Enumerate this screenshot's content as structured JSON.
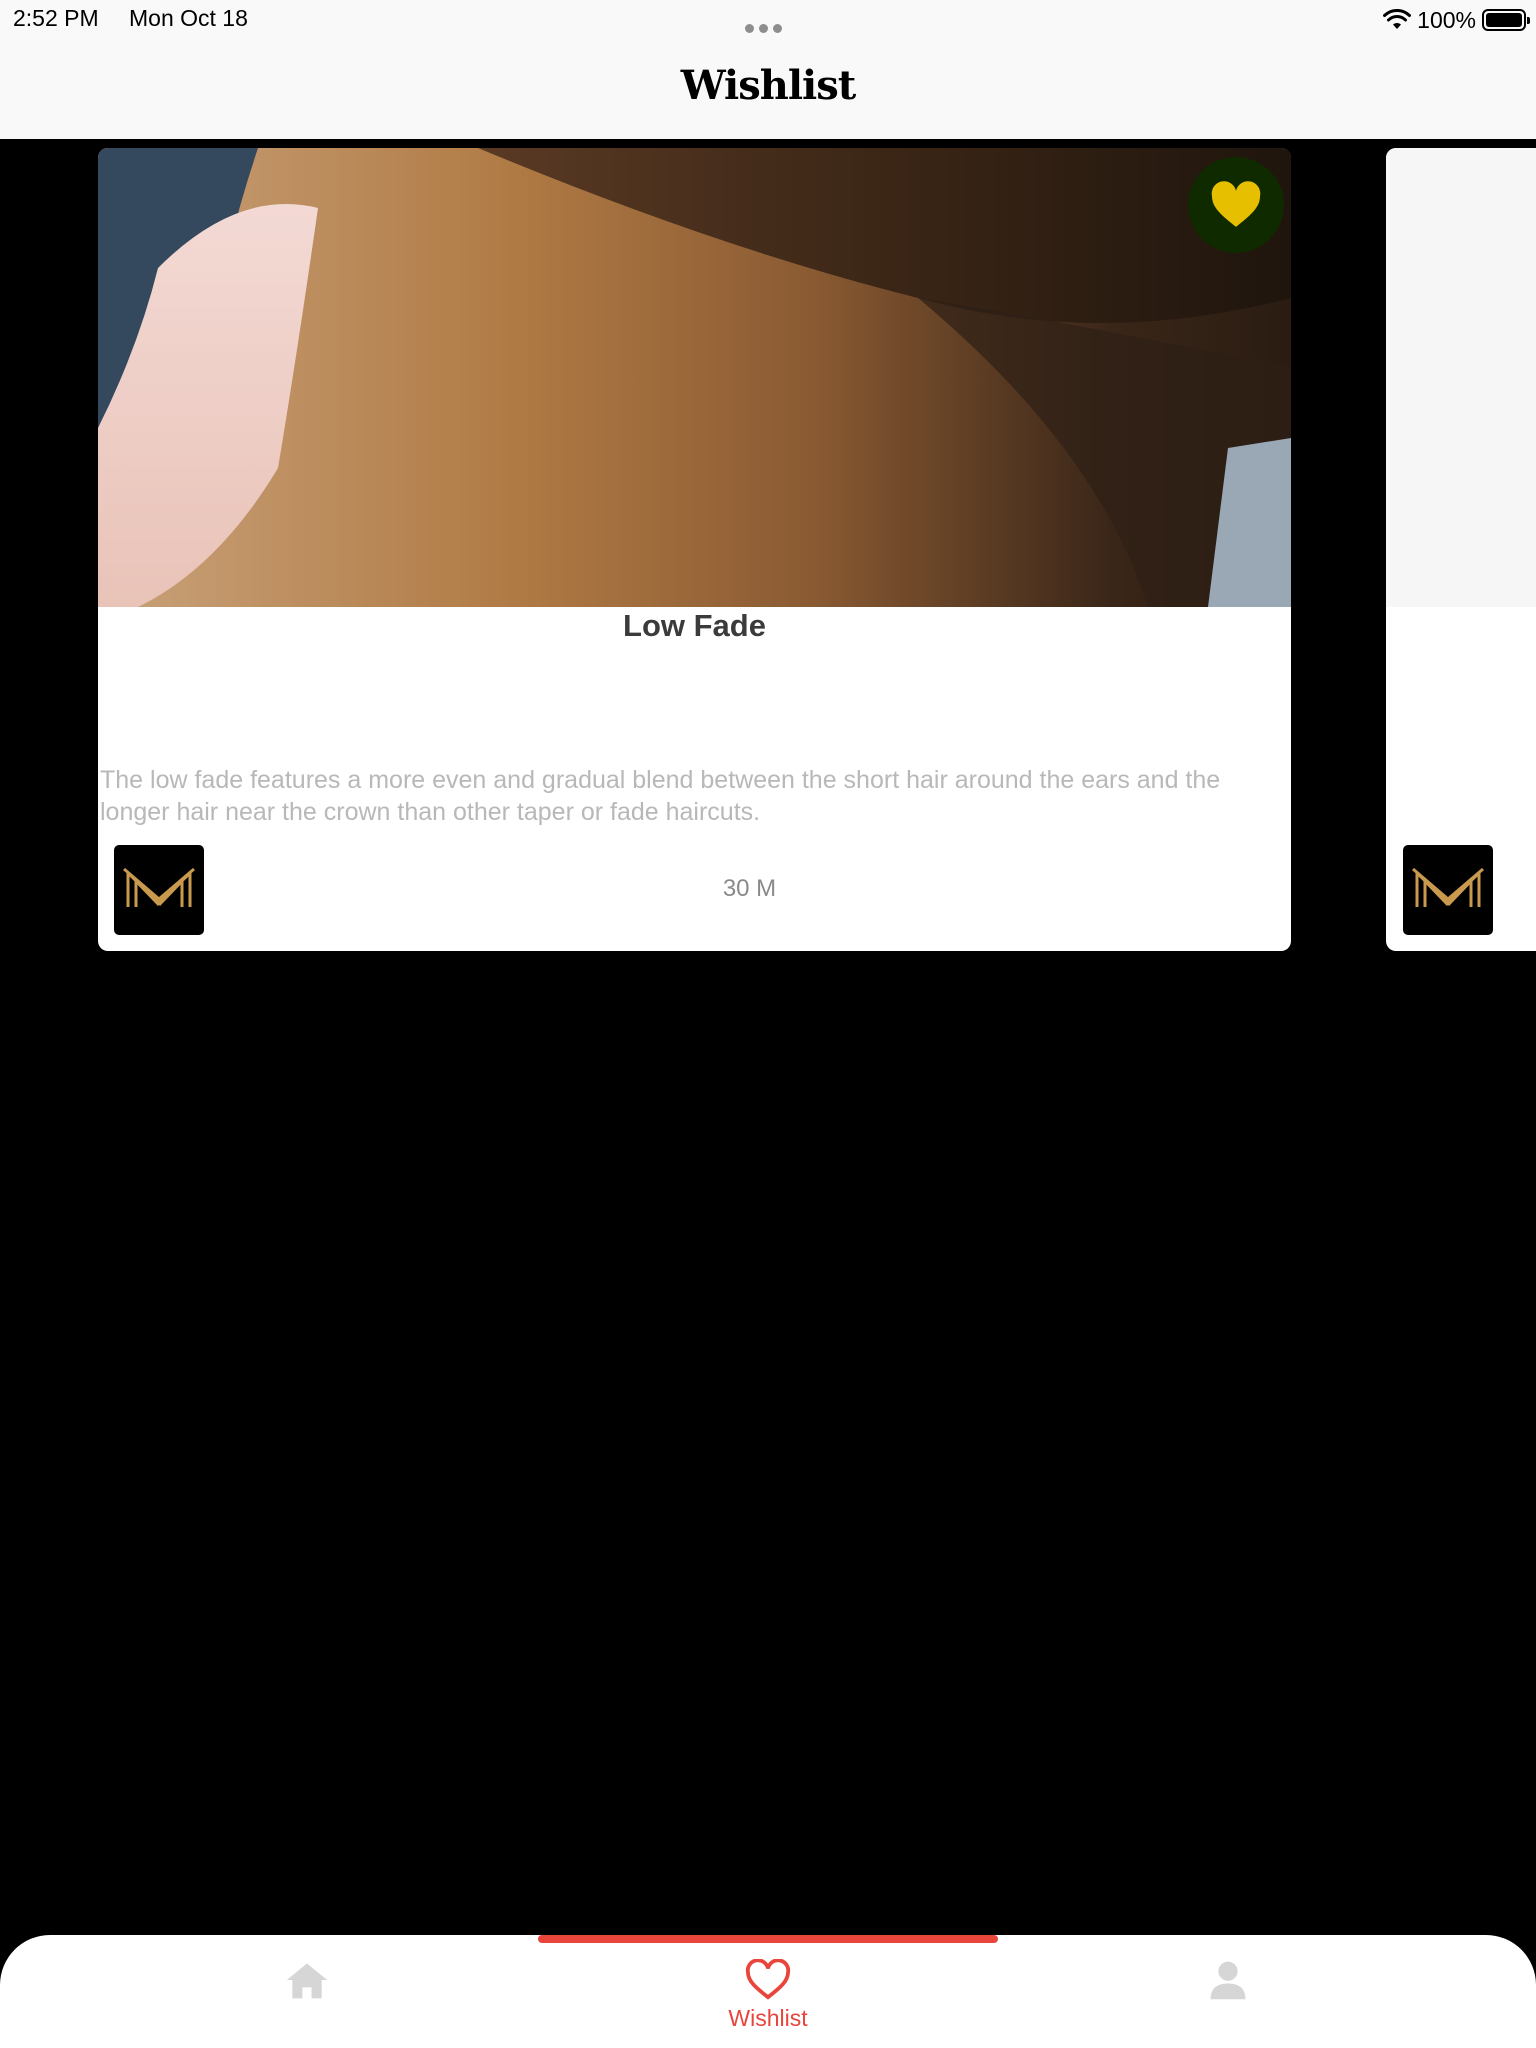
{
  "status_bar": {
    "time": "2:52 PM",
    "date": "Mon Oct 18",
    "battery": "100%"
  },
  "header": {
    "title": "Wishlist"
  },
  "cards": [
    {
      "title": "Low Fade",
      "description": "The low fade features a more even and gradual blend between the short hair around the ears and the longer hair near the crown than other taper or fade haircuts.",
      "duration": "30 M",
      "favorited": true
    }
  ],
  "tab_bar": {
    "tabs": [
      {
        "icon": "home-icon",
        "label": "",
        "active": false
      },
      {
        "icon": "heart-icon",
        "label": "Wishlist",
        "active": true
      },
      {
        "icon": "person-icon",
        "label": "",
        "active": false
      }
    ]
  },
  "colors": {
    "accent": "#e8453c",
    "favorite_heart": "#e6bf00",
    "favorite_bg": "#102a00",
    "logo_gold": "#c99a4e",
    "inactive_tab": "#d6d6d6"
  }
}
